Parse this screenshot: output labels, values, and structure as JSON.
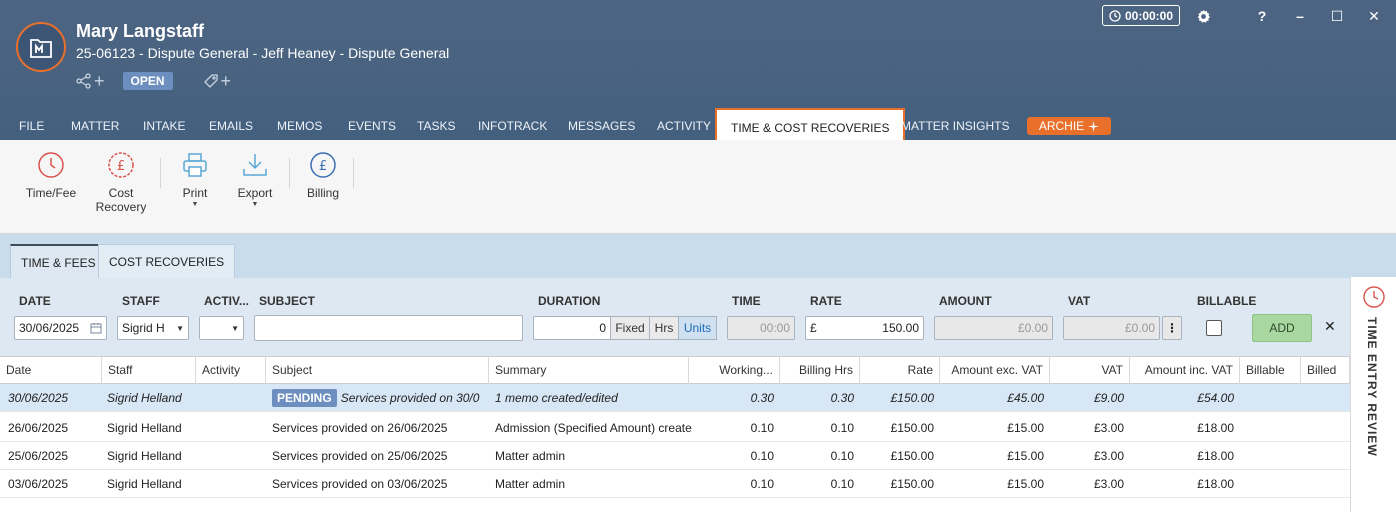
{
  "header": {
    "client_name": "Mary Langstaff",
    "matter_line": "25-06123 - Dispute General - Jeff Heaney - Dispute General",
    "status": "OPEN",
    "timer": "00:00:00",
    "help": "?",
    "minimize": "–",
    "maximize": "☐",
    "close": "✕"
  },
  "nav": {
    "tabs": [
      "FILE",
      "MATTER",
      "INTAKE",
      "EMAILS",
      "MEMOS",
      "EVENTS",
      "TASKS",
      "INFOTRACK",
      "MESSAGES",
      "ACTIVITY",
      "TIME & COST RECOVERIES",
      "MATTER INSIGHTS"
    ],
    "active": "TIME & COST RECOVERIES",
    "archie": "ARCHIE"
  },
  "ribbon": {
    "time_fee": "Time/Fee",
    "cost_recovery_1": "Cost",
    "cost_recovery_2": "Recovery",
    "print": "Print",
    "export": "Export",
    "billing": "Billing"
  },
  "subtabs": {
    "time_fees": "TIME & FEES",
    "cost_recoveries": "COST RECOVERIES"
  },
  "form": {
    "labels": {
      "date": "DATE",
      "staff": "STAFF",
      "activity": "ACTIV...",
      "subject": "SUBJECT",
      "duration": "DURATION",
      "time": "TIME",
      "rate": "RATE",
      "amount": "AMOUNT",
      "vat": "VAT",
      "billable": "BILLABLE"
    },
    "date": "30/06/2025",
    "staff": "Sigrid H",
    "activity": "",
    "subject": "",
    "duration": "0",
    "fixed": "Fixed",
    "hrs": "Hrs",
    "units": "Units",
    "time": "00:00",
    "rate_currency": "£",
    "rate": "150.00",
    "amount": "£0.00",
    "vat": "£0.00",
    "add": "ADD",
    "clear": "✕"
  },
  "side_panel": {
    "label": "TIME ENTRY REVIEW"
  },
  "table": {
    "columns": [
      "Date",
      "Staff",
      "Activity",
      "Subject",
      "Summary",
      "Working...",
      "Billing Hrs",
      "Rate",
      "Amount exc. VAT",
      "VAT",
      "Amount inc. VAT",
      "Billable",
      "Billed"
    ],
    "pending_label": "PENDING",
    "rows": [
      {
        "date": "30/06/2025",
        "staff": "Sigrid Helland",
        "activity": "",
        "subject": "Services provided on 30/0",
        "summary": "1 memo created/edited",
        "working": "0.30",
        "billing": "0.30",
        "rate": "£150.00",
        "amount_exc": "£45.00",
        "vat": "£9.00",
        "amount_inc": "£54.00"
      },
      {
        "date": "26/06/2025",
        "staff": "Sigrid Helland",
        "activity": "",
        "subject": "Services provided on 26/06/2025",
        "summary": "Admission (Specified Amount) create",
        "working": "0.10",
        "billing": "0.10",
        "rate": "£150.00",
        "amount_exc": "£15.00",
        "vat": "£3.00",
        "amount_inc": "£18.00"
      },
      {
        "date": "25/06/2025",
        "staff": "Sigrid Helland",
        "activity": "",
        "subject": "Services provided on 25/06/2025",
        "summary": "Matter admin",
        "working": "0.10",
        "billing": "0.10",
        "rate": "£150.00",
        "amount_exc": "£15.00",
        "vat": "£3.00",
        "amount_inc": "£18.00"
      },
      {
        "date": "03/06/2025",
        "staff": "Sigrid Helland",
        "activity": "",
        "subject": "Services provided on 03/06/2025",
        "summary": "Matter admin",
        "working": "0.10",
        "billing": "0.10",
        "rate": "£150.00",
        "amount_exc": "£15.00",
        "vat": "£3.00",
        "amount_inc": "£18.00"
      }
    ]
  },
  "colors": {
    "header_bg": "#4d6582",
    "accent": "#e8702a",
    "badge": "#6d8fc0",
    "selected_row": "#d7e7f5"
  }
}
